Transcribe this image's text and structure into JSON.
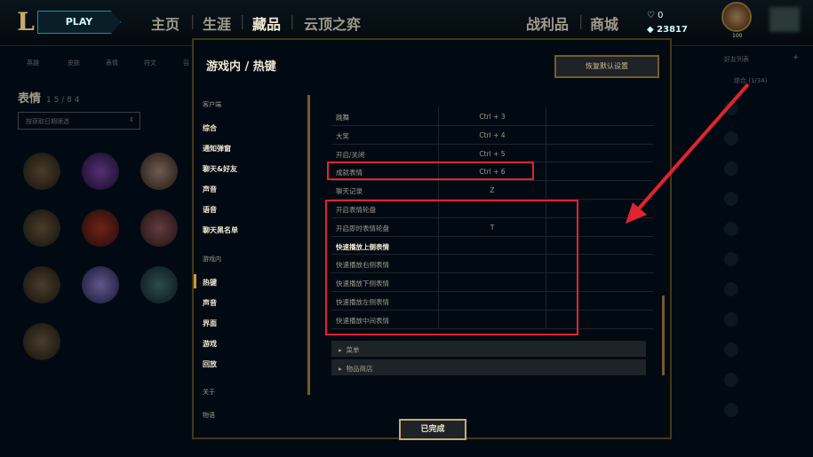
{
  "topbar": {
    "play_label": "PLAY",
    "nav": [
      "主页",
      "生涯",
      "藏品",
      "云顶之弈"
    ],
    "nav_right": [
      "战利品",
      "商城"
    ],
    "currency_top": "0",
    "currency_bottom": "23817",
    "level": "100"
  },
  "collection": {
    "subtabs": [
      "英雄",
      "皮肤",
      "表情",
      "符文",
      "召"
    ],
    "title": "表情",
    "count": "1 5 / 8 4",
    "filter_placeholder": "按获取日期筛选"
  },
  "friends": {
    "header": "好友列表",
    "group": "综合 (1/34)"
  },
  "modal": {
    "title": "游戏内 / 热键",
    "reset_label": "恢复默认设置",
    "done_label": "已完成",
    "sidebar": {
      "client_header": "客户端",
      "client_items": [
        "综合",
        "通知弹窗",
        "聊天&好友",
        "声音",
        "语音",
        "聊天黑名单"
      ],
      "ingame_header": "游戏内",
      "ingame_items": [
        "热键",
        "声音",
        "界面",
        "游戏",
        "回放"
      ],
      "about_header": "关于",
      "about_items": [
        "物语"
      ]
    },
    "rows": [
      {
        "action": "跳舞",
        "key": "Ctrl + 3"
      },
      {
        "action": "大笑",
        "key": "Ctrl + 4"
      },
      {
        "action": "开启/关闭",
        "key": "Ctrl + 5"
      },
      {
        "action": "成就表情",
        "key": "Ctrl + 6"
      },
      {
        "action": "聊天记录",
        "key": "Z"
      },
      {
        "action": "开启表情轮盘",
        "key": ""
      },
      {
        "action": "开启即时表情轮盘",
        "key": "T"
      },
      {
        "action": "快速播放上侧表情",
        "key": ""
      },
      {
        "action": "快速播放右侧表情",
        "key": ""
      },
      {
        "action": "快速播放下侧表情",
        "key": ""
      },
      {
        "action": "快速播放左侧表情",
        "key": ""
      },
      {
        "action": "快速播放中间表情",
        "key": ""
      }
    ],
    "sections": [
      "菜单",
      "物品商店"
    ]
  }
}
